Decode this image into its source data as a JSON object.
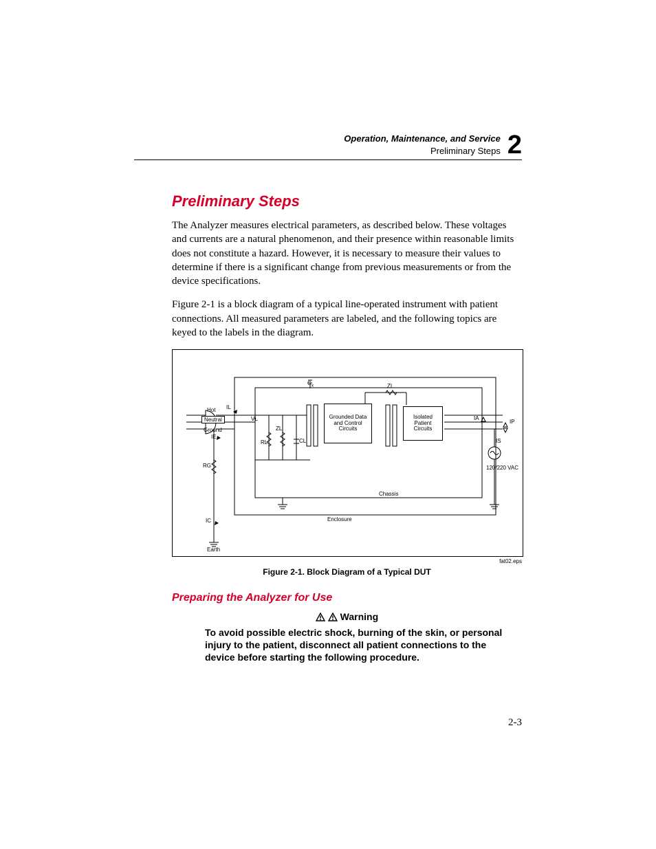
{
  "header": {
    "line1": "Operation, Maintenance, and Service",
    "line2": "Preliminary Steps",
    "chapter_number": "2"
  },
  "section_title": "Preliminary Steps",
  "para1": "The Analyzer measures electrical parameters, as described below. These voltages and currents are a natural phenomenon, and their presence within reasonable limits does not constitute a hazard. However, it is necessary to measure their values to determine if there is a significant change from previous measurements or from the device specifications.",
  "para2": "Figure 2-1 is a block diagram of a typical line-operated instrument with patient connections. All measured parameters are labeled, and the following topics are keyed to the labels in the diagram.",
  "figure": {
    "caption": "Figure 2-1. Block Diagram of a Typical DUT",
    "eps": "fat02.eps",
    "labels": {
      "hot": "Hot",
      "neutral": "Neutral",
      "ground": "Ground",
      "grounded": "Grounded Data and Control Circuits",
      "isolated": "Isolated Patient Circuits",
      "chassis": "Chassis",
      "enclosure": "Enclosure",
      "earth": "Earth",
      "vac": "120/220 VAC",
      "IL": "IL",
      "IE": "IE",
      "IC": "IC",
      "VL": "VL",
      "RL": "RL",
      "ZL": "ZL",
      "CL": "CL",
      "ZI": "ZI",
      "RG": "RG",
      "IA": "IA",
      "IS": "IS",
      "IP": "IP"
    }
  },
  "subsection_title": "Preparing the Analyzer for Use",
  "warning": {
    "label": "Warning",
    "body": "To avoid possible electric shock, burning of the skin, or personal injury to the patient, disconnect all patient connections to the device before starting the following procedure."
  },
  "page_number": "2-3"
}
